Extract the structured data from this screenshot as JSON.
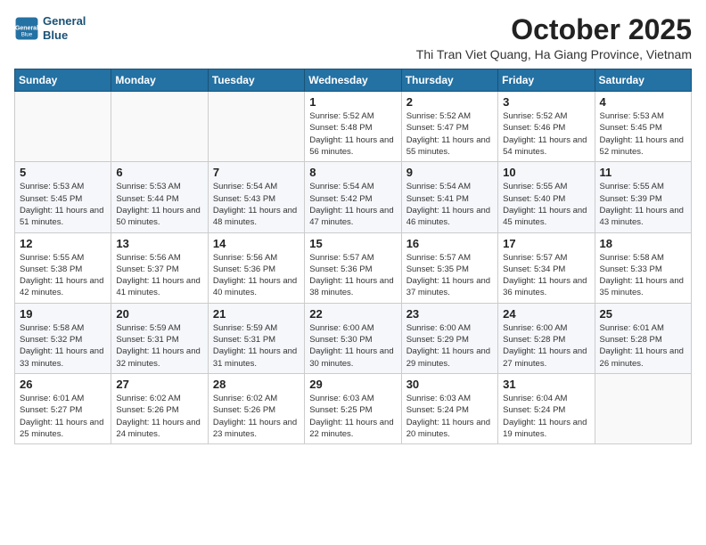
{
  "header": {
    "logo_line1": "General",
    "logo_line2": "Blue",
    "month_title": "October 2025",
    "subtitle": "Thi Tran Viet Quang, Ha Giang Province, Vietnam"
  },
  "days_of_week": [
    "Sunday",
    "Monday",
    "Tuesday",
    "Wednesday",
    "Thursday",
    "Friday",
    "Saturday"
  ],
  "weeks": [
    [
      {
        "day": "",
        "sunrise": "",
        "sunset": "",
        "daylight": ""
      },
      {
        "day": "",
        "sunrise": "",
        "sunset": "",
        "daylight": ""
      },
      {
        "day": "",
        "sunrise": "",
        "sunset": "",
        "daylight": ""
      },
      {
        "day": "1",
        "sunrise": "Sunrise: 5:52 AM",
        "sunset": "Sunset: 5:48 PM",
        "daylight": "Daylight: 11 hours and 56 minutes."
      },
      {
        "day": "2",
        "sunrise": "Sunrise: 5:52 AM",
        "sunset": "Sunset: 5:47 PM",
        "daylight": "Daylight: 11 hours and 55 minutes."
      },
      {
        "day": "3",
        "sunrise": "Sunrise: 5:52 AM",
        "sunset": "Sunset: 5:46 PM",
        "daylight": "Daylight: 11 hours and 54 minutes."
      },
      {
        "day": "4",
        "sunrise": "Sunrise: 5:53 AM",
        "sunset": "Sunset: 5:45 PM",
        "daylight": "Daylight: 11 hours and 52 minutes."
      }
    ],
    [
      {
        "day": "5",
        "sunrise": "Sunrise: 5:53 AM",
        "sunset": "Sunset: 5:45 PM",
        "daylight": "Daylight: 11 hours and 51 minutes."
      },
      {
        "day": "6",
        "sunrise": "Sunrise: 5:53 AM",
        "sunset": "Sunset: 5:44 PM",
        "daylight": "Daylight: 11 hours and 50 minutes."
      },
      {
        "day": "7",
        "sunrise": "Sunrise: 5:54 AM",
        "sunset": "Sunset: 5:43 PM",
        "daylight": "Daylight: 11 hours and 48 minutes."
      },
      {
        "day": "8",
        "sunrise": "Sunrise: 5:54 AM",
        "sunset": "Sunset: 5:42 PM",
        "daylight": "Daylight: 11 hours and 47 minutes."
      },
      {
        "day": "9",
        "sunrise": "Sunrise: 5:54 AM",
        "sunset": "Sunset: 5:41 PM",
        "daylight": "Daylight: 11 hours and 46 minutes."
      },
      {
        "day": "10",
        "sunrise": "Sunrise: 5:55 AM",
        "sunset": "Sunset: 5:40 PM",
        "daylight": "Daylight: 11 hours and 45 minutes."
      },
      {
        "day": "11",
        "sunrise": "Sunrise: 5:55 AM",
        "sunset": "Sunset: 5:39 PM",
        "daylight": "Daylight: 11 hours and 43 minutes."
      }
    ],
    [
      {
        "day": "12",
        "sunrise": "Sunrise: 5:55 AM",
        "sunset": "Sunset: 5:38 PM",
        "daylight": "Daylight: 11 hours and 42 minutes."
      },
      {
        "day": "13",
        "sunrise": "Sunrise: 5:56 AM",
        "sunset": "Sunset: 5:37 PM",
        "daylight": "Daylight: 11 hours and 41 minutes."
      },
      {
        "day": "14",
        "sunrise": "Sunrise: 5:56 AM",
        "sunset": "Sunset: 5:36 PM",
        "daylight": "Daylight: 11 hours and 40 minutes."
      },
      {
        "day": "15",
        "sunrise": "Sunrise: 5:57 AM",
        "sunset": "Sunset: 5:36 PM",
        "daylight": "Daylight: 11 hours and 38 minutes."
      },
      {
        "day": "16",
        "sunrise": "Sunrise: 5:57 AM",
        "sunset": "Sunset: 5:35 PM",
        "daylight": "Daylight: 11 hours and 37 minutes."
      },
      {
        "day": "17",
        "sunrise": "Sunrise: 5:57 AM",
        "sunset": "Sunset: 5:34 PM",
        "daylight": "Daylight: 11 hours and 36 minutes."
      },
      {
        "day": "18",
        "sunrise": "Sunrise: 5:58 AM",
        "sunset": "Sunset: 5:33 PM",
        "daylight": "Daylight: 11 hours and 35 minutes."
      }
    ],
    [
      {
        "day": "19",
        "sunrise": "Sunrise: 5:58 AM",
        "sunset": "Sunset: 5:32 PM",
        "daylight": "Daylight: 11 hours and 33 minutes."
      },
      {
        "day": "20",
        "sunrise": "Sunrise: 5:59 AM",
        "sunset": "Sunset: 5:31 PM",
        "daylight": "Daylight: 11 hours and 32 minutes."
      },
      {
        "day": "21",
        "sunrise": "Sunrise: 5:59 AM",
        "sunset": "Sunset: 5:31 PM",
        "daylight": "Daylight: 11 hours and 31 minutes."
      },
      {
        "day": "22",
        "sunrise": "Sunrise: 6:00 AM",
        "sunset": "Sunset: 5:30 PM",
        "daylight": "Daylight: 11 hours and 30 minutes."
      },
      {
        "day": "23",
        "sunrise": "Sunrise: 6:00 AM",
        "sunset": "Sunset: 5:29 PM",
        "daylight": "Daylight: 11 hours and 29 minutes."
      },
      {
        "day": "24",
        "sunrise": "Sunrise: 6:00 AM",
        "sunset": "Sunset: 5:28 PM",
        "daylight": "Daylight: 11 hours and 27 minutes."
      },
      {
        "day": "25",
        "sunrise": "Sunrise: 6:01 AM",
        "sunset": "Sunset: 5:28 PM",
        "daylight": "Daylight: 11 hours and 26 minutes."
      }
    ],
    [
      {
        "day": "26",
        "sunrise": "Sunrise: 6:01 AM",
        "sunset": "Sunset: 5:27 PM",
        "daylight": "Daylight: 11 hours and 25 minutes."
      },
      {
        "day": "27",
        "sunrise": "Sunrise: 6:02 AM",
        "sunset": "Sunset: 5:26 PM",
        "daylight": "Daylight: 11 hours and 24 minutes."
      },
      {
        "day": "28",
        "sunrise": "Sunrise: 6:02 AM",
        "sunset": "Sunset: 5:26 PM",
        "daylight": "Daylight: 11 hours and 23 minutes."
      },
      {
        "day": "29",
        "sunrise": "Sunrise: 6:03 AM",
        "sunset": "Sunset: 5:25 PM",
        "daylight": "Daylight: 11 hours and 22 minutes."
      },
      {
        "day": "30",
        "sunrise": "Sunrise: 6:03 AM",
        "sunset": "Sunset: 5:24 PM",
        "daylight": "Daylight: 11 hours and 20 minutes."
      },
      {
        "day": "31",
        "sunrise": "Sunrise: 6:04 AM",
        "sunset": "Sunset: 5:24 PM",
        "daylight": "Daylight: 11 hours and 19 minutes."
      },
      {
        "day": "",
        "sunrise": "",
        "sunset": "",
        "daylight": ""
      }
    ]
  ]
}
